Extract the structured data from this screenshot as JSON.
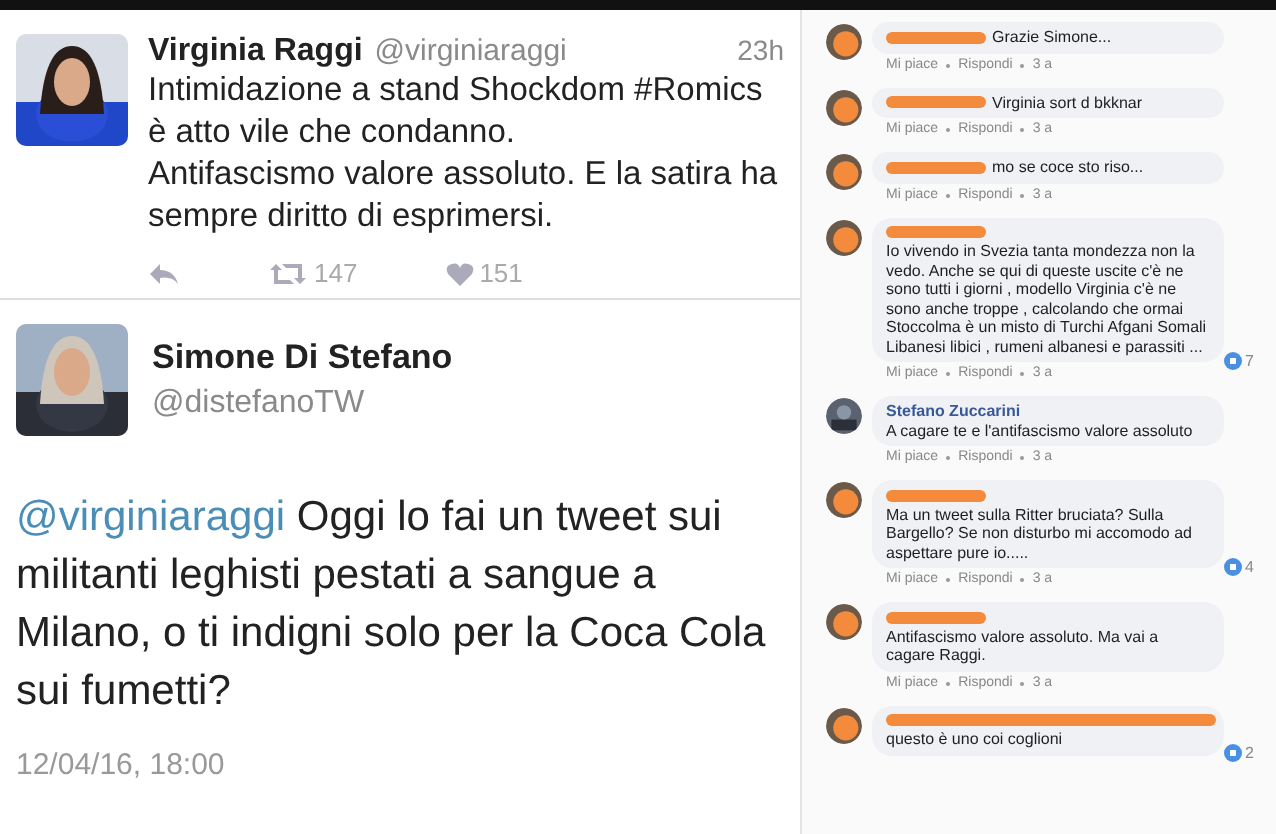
{
  "tweets": [
    {
      "kind": "compact",
      "name": "Virginia Raggi",
      "handle": "@virginiaraggi",
      "time": "23h",
      "text": [
        "Intimidazione a stand Shockdom #Romics",
        "è atto vile che condanno.",
        "Antifascismo valore assoluto. E la satira ha",
        "sempre diritto di esprimersi."
      ],
      "retweets": "147",
      "likes": "151"
    },
    {
      "kind": "expanded",
      "name": "Simone Di Stefano",
      "handle": "@distefanoTW",
      "mention": "@virginiaraggi",
      "text": "Oggi lo fai un tweet sui militanti leghisti pestati a sangue a Milano, o ti indigni solo per la Coca Cola sui fumetti?",
      "time": "12/04/16, 18:00"
    }
  ],
  "comments": [
    {
      "redacted": true,
      "long": false,
      "text": "Grazie Simone...",
      "actions": [
        "Mi piace",
        "Rispondi",
        "3 a"
      ]
    },
    {
      "redacted": true,
      "long": false,
      "text": "Virginia sort d bkknar",
      "actions": [
        "Mi piace",
        "Rispondi",
        "3 a"
      ]
    },
    {
      "redacted": true,
      "long": false,
      "text": "mo se coce sto riso...",
      "actions": [
        "Mi piace",
        "Rispondi",
        "3 a"
      ]
    },
    {
      "redacted": true,
      "long": false,
      "text": "Io vivendo in Svezia tanta mondezza non la vedo. Anche se qui di queste uscite c'è ne sono tutti i giorni , modello Virginia c'è ne sono anche troppe , calcolando che ormai Stoccolma è un misto di Turchi Afgani Somali Libanesi libici , rumeni albanesi e parassiti ...",
      "actions": [
        "Mi piace",
        "Rispondi",
        "3 a"
      ],
      "reactions": "7"
    },
    {
      "redacted": false,
      "name": "Stefano Zuccarini",
      "text": "A cagare te e l'antifascismo valore assoluto",
      "actions": [
        "Mi piace",
        "Rispondi",
        "3 a"
      ]
    },
    {
      "redacted": true,
      "long": false,
      "text": "Ma un tweet sulla Ritter bruciata? Sulla Bargello? Se non disturbo mi accomodo ad aspettare pure io.....",
      "actions": [
        "Mi piace",
        "Rispondi",
        "3 a"
      ],
      "reactions": "4"
    },
    {
      "redacted": true,
      "long": false,
      "text": "Antifascismo valore assoluto. Ma vai a cagare Raggi.",
      "actions": [
        "Mi piace",
        "Rispondi",
        "3 a"
      ]
    },
    {
      "redacted": true,
      "long": true,
      "text": "questo è uno coi coglioni",
      "reactions": "2"
    }
  ]
}
